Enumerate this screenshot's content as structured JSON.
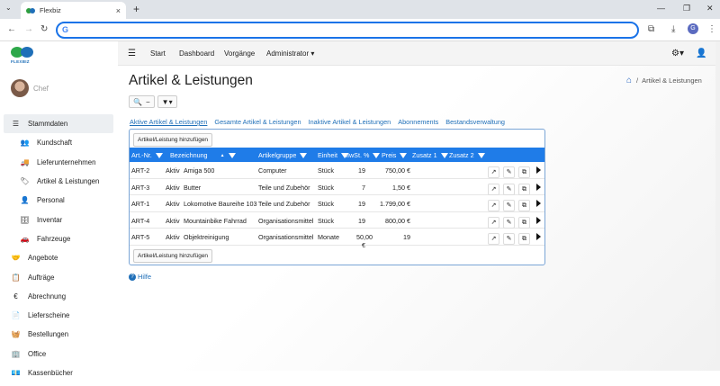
{
  "browser": {
    "tab_title": "Flexbiz",
    "tab_close": "×",
    "new_tab": "+",
    "url": "",
    "profile_initial": "G"
  },
  "logo": {
    "text": "FLEXBIZ"
  },
  "user": {
    "name": "Chef"
  },
  "sidebar": {
    "items": [
      {
        "label": "Stammdaten",
        "icon": "list-icon",
        "level": 0,
        "active": true
      },
      {
        "label": "Kundschaft",
        "icon": "users-icon",
        "level": 1
      },
      {
        "label": "Lieferunternehmen",
        "icon": "truck-icon",
        "level": 1
      },
      {
        "label": "Artikel & Leistungen",
        "icon": "tag-icon",
        "level": 1
      },
      {
        "label": "Personal",
        "icon": "person-icon",
        "level": 1
      },
      {
        "label": "Inventar",
        "icon": "desk-icon",
        "level": 1
      },
      {
        "label": "Fahrzeuge",
        "icon": "car-icon",
        "level": 1
      },
      {
        "label": "Angebote",
        "icon": "handshake-icon",
        "level": 0
      },
      {
        "label": "Aufträge",
        "icon": "checklist-icon",
        "level": 0
      },
      {
        "label": "Abrechnung",
        "icon": "euro-icon",
        "level": 0
      },
      {
        "label": "Lieferscheine",
        "icon": "docs-icon",
        "level": 0
      },
      {
        "label": "Bestellungen",
        "icon": "basket-icon",
        "level": 0
      },
      {
        "label": "Office",
        "icon": "office-icon",
        "level": 0
      },
      {
        "label": "Kassenbücher",
        "icon": "cashbook-icon",
        "level": 0
      }
    ]
  },
  "topnav": {
    "items": [
      "Start",
      "Dashboard",
      "Vorgänge",
      "Administrator"
    ]
  },
  "page": {
    "title": "Artikel & Leistungen",
    "breadcrumb": "Artikel & Leistungen",
    "breadcrumb_sep": "/"
  },
  "filter": {
    "search": "🔍",
    "minus": "−",
    "funnel": "▼"
  },
  "links": [
    "Aktive Artikel & Leistungen",
    "Gesamte Artikel & Leistungen",
    "Inaktive Artikel & Leistungen",
    "Abonnements",
    "Bestandsverwaltung"
  ],
  "add_button": "Artikel/Leistung hinzufügen",
  "table": {
    "columns": [
      "Art.-Nr.",
      "Bezeichnung",
      "Artikelgruppe",
      "Einheit",
      "MwSt. %",
      "Preis",
      "Zusatz 1",
      "Zusatz 2"
    ],
    "rows": [
      [
        "ART-2",
        "Aktiv",
        "Amiga 500",
        "Computer",
        "Stück",
        "19",
        "750,00 €"
      ],
      [
        "ART-3",
        "Aktiv",
        "Butter",
        "Teile und Zubehör",
        "Stück",
        "7",
        "1,50 €"
      ],
      [
        "ART-1",
        "Aktiv",
        "Lokomotive Baureihe 103",
        "Teile und Zubehör",
        "Stück",
        "19",
        "1.799,00 €"
      ],
      [
        "ART-4",
        "Aktiv",
        "Mountainbike Fahrrad",
        "Organisationsmittel",
        "Stück",
        "19",
        "800,00 €"
      ],
      [
        "ART-5",
        "Aktiv",
        "Objektreinigung",
        "Organisationsmittel",
        "Monate",
        "50,00 €",
        "19"
      ]
    ]
  },
  "help": "Hilfe"
}
